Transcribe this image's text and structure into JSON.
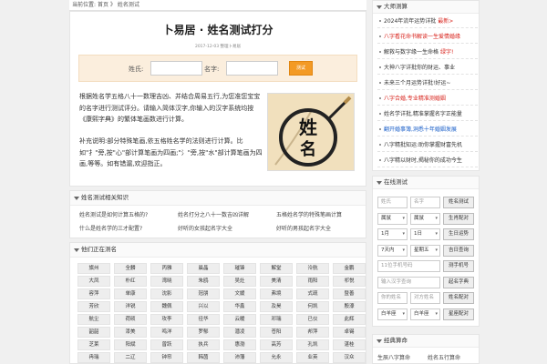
{
  "breadcrumb": {
    "label": "当前位置:",
    "home": "首页",
    "sep": "》",
    "current": "姓名测试"
  },
  "article": {
    "title": "卜易居 · 姓名测试打分",
    "meta": "2017-12-03 整理卜易居",
    "form": {
      "surname_label": "姓氏:",
      "name_label": "名字:",
      "submit": "测试",
      "surname_value": "",
      "name_value": ""
    },
    "para1": "根据姓名学五格八十一数理吉凶、并结合周易五行,为您准您宝宝的名字进行测试评分。请输入简体汉字,你输入的汉字系统均按《康熙字典》的繁体笔画数进行计算。",
    "para2": "补充说明:部分特殊笔画,依五格姓名学的法则进行计算。比如\"扌\"旁,按\"心\"部计算笔画为四画;\"氵\"旁,按\"水\"部计算笔画为四画,等等。如有错漏,欢迎指正。",
    "image_text": "姓名"
  },
  "related": {
    "heading": "姓名测试相关知识",
    "links": [
      "姓名测试是如何计算五格的?",
      "姓名打分之八十一数吉凶详解",
      "五格姓名学的特殊笔画计算",
      "什么是姓名学的三才配置?",
      "好听的女孩起名字大全",
      "好听的男孩起名字大全"
    ]
  },
  "names": {
    "heading": "他们正在测名",
    "rows": [
      [
        "旗州",
        "全麟",
        "丙雅",
        "晨晶",
        "璀锋",
        "解堂",
        "泠航",
        "金鹏"
      ],
      [
        "大凤",
        "朴红",
        "湾晓",
        "朱鸥",
        "吴灶",
        "美清",
        "雨阳",
        "祁悦"
      ],
      [
        "容萍",
        "单康",
        "沈影",
        "冠朋",
        "文媛",
        "弗境",
        "式疏",
        "暨善"
      ],
      [
        "芳欣",
        "洋锐",
        "魏佩",
        "兴以",
        "华鑫",
        "及昊",
        "何凯",
        "殷濠"
      ],
      [
        "航尘",
        "荷硕",
        "攻李",
        "径华",
        "云暖",
        "邓瑞",
        "已仪",
        "此辉"
      ],
      [
        "韶韶",
        "漆美",
        "鸣洋",
        "罗郁",
        "潜凌",
        "苍阳",
        "邦萍",
        "卓锡"
      ],
      [
        "芝莱",
        "阳斌",
        "曾跃",
        "执兵",
        "惠渤",
        "高芳",
        "孔凯",
        "湛桂"
      ],
      [
        "冉瑞",
        "二辽",
        "钟帘",
        "韩茵",
        "沛藩",
        "允永",
        "业英",
        "汉众"
      ]
    ]
  },
  "sidebar": {
    "heading": "大师测算",
    "items": [
      {
        "text": "2024年流年运势详批",
        "badge": "最新>",
        "color": "#333333"
      },
      {
        "text": "八字看花命书解读一生爱情婚缘",
        "badge": "",
        "color": "#d8231c"
      },
      {
        "text": "解救与数字缘一生命格",
        "badge": "绿字!",
        "color": "#333333"
      },
      {
        "text": "大神八字详批你的财运、事业",
        "badge": "",
        "color": "#333333"
      },
      {
        "text": "未来三个月运势详批!好运~",
        "badge": "",
        "color": "#333333"
      },
      {
        "text": "八字合婚,专业精准测婚姻",
        "badge": "",
        "color": "#d8231c"
      },
      {
        "text": "姓名学详批,精准掌握名字正能量",
        "badge": "",
        "color": "#333333"
      },
      {
        "text": "翻开婚事簿,洞悉十年婚姻发展",
        "badge": "",
        "color": "#1a5fc9"
      },
      {
        "text": "八字精批知运:助你掌握财富先机",
        "badge": "",
        "color": "#333333"
      },
      {
        "text": "八字精以财时,揭秘你的成功今生",
        "badge": "",
        "color": "#333333"
      }
    ],
    "tool": {
      "heading": "在线测试",
      "row1": [
        "姓氏",
        "名字",
        "姓名测试"
      ],
      "row2": [
        "属鼠",
        "属鼠",
        "生肖配对"
      ],
      "row3": [
        "1月",
        "1日",
        "生日运势"
      ],
      "row4": [
        "7天内",
        "星期五",
        "吉日查询"
      ],
      "row5": [
        "11位手机号码",
        "测手机号"
      ],
      "row6": [
        "输入汉字查询",
        "起名字典"
      ],
      "row7": [
        "你的姓名",
        "对方姓名",
        "姓名配对"
      ],
      "row8": [
        "白羊座",
        "白羊座",
        "星座配对"
      ]
    },
    "bottom": {
      "heading": "经典算命",
      "links": [
        "生辰八字算命",
        "姓名五行算命"
      ]
    }
  },
  "colors": {
    "accent": "#f39a25",
    "form_bg": "#fbeedd"
  }
}
